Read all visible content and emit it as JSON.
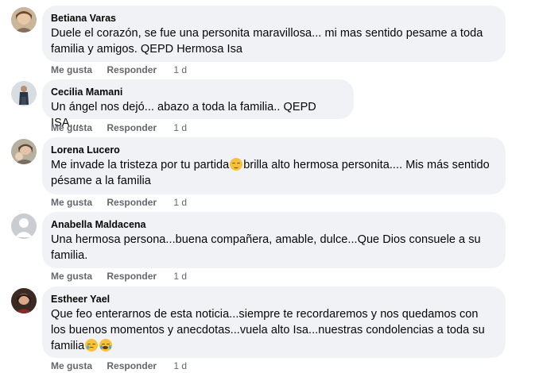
{
  "comments": [
    {
      "author": "Betiana Varas",
      "text": "Duele el corazón, se fue una personita maravillosa... mi mas sentido pesame a toda familia y amigos. QEPD Hermosa Isa",
      "like": "Me gusta",
      "reply": "Responder",
      "time": "1 d"
    },
    {
      "author": "Cecilia Mamani",
      "text": "Un ángel nos dejó... abazo a toda la familia.. QEPD ISA....",
      "like": "Me gusta",
      "reply": "Responder",
      "time": "1 d"
    },
    {
      "author": "Lorena Lucero",
      "text_a": "Me invade la tristeza por tu partida",
      "text_b": "brilla alto hermosa personita.... Mis más sentido pésame a la familia",
      "like": "Me gusta",
      "reply": "Responder",
      "time": "1 d"
    },
    {
      "author": "Anabella Maldacena",
      "text": "Una hermosa persona...buena compañera, amable, dulce...Que Dios consuele a su familia.",
      "like": "Me gusta",
      "reply": "Responder",
      "time": "1 d"
    },
    {
      "author": "Estheer Yael",
      "text": "Que feo enterarnos de esta noticia...siempre te recordaremos y nos quedamos con los buenos momentos y anecdotas...vuela alto Isa...nuestras condolencias a toda su familia",
      "like": "Me gusta",
      "reply": "Responder",
      "time": "1 d"
    }
  ],
  "icons": {
    "pensive": "pensive-face-emoji",
    "sad": "sad-face-emoji",
    "crying": "crying-face-emoji"
  },
  "colors": {
    "bubble": "#f0f2f5",
    "text": "#050505",
    "secondary": "#65676b"
  }
}
